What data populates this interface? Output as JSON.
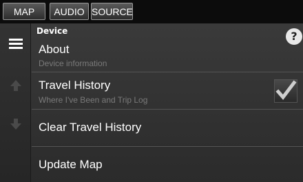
{
  "tabs": {
    "map": "MAP",
    "audio": "AUDIO",
    "source": "SOURCE"
  },
  "section": {
    "title": "Device",
    "help": "?"
  },
  "items": [
    {
      "label": "About",
      "sub": "Device information"
    },
    {
      "label": "Travel History",
      "sub": "Where I've Been and Trip Log",
      "checked": true
    },
    {
      "label": "Clear Travel History"
    },
    {
      "label": "Update Map"
    }
  ],
  "icons": {
    "menu": "hamburger-menu-icon",
    "up": "arrow-up-icon",
    "down": "arrow-down-icon",
    "check": "checkmark-icon"
  }
}
